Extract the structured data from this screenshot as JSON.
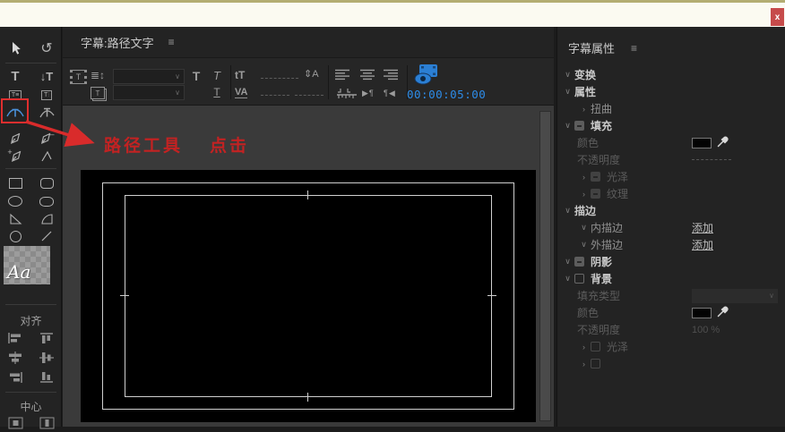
{
  "window": {
    "close": "x"
  },
  "icons": {
    "menu": "≡",
    "chevron_open": "∨",
    "chevron_closed": "›",
    "combo_chevron": "∨",
    "rotate": "↺",
    "type": "T",
    "vertical_type": "↓T",
    "area_type_h": "T≡",
    "area_type_v": "T⫶",
    "pen_minus": "–",
    "pen_plus": "+",
    "roll_crawl": "≣↕",
    "film_t": "T",
    "templates_t": "T",
    "bold_t": "T",
    "italic_t": "T",
    "underline_t": "T",
    "font_size": "tT",
    "leading": "⇕A",
    "kerning": "VA",
    "para_right": "▶¶",
    "para_left": "¶◀"
  },
  "titler": {
    "title": "字幕:路径文字",
    "timecode": "00:00:05:00"
  },
  "annotation": {
    "label": "路径工具",
    "action": "点击"
  },
  "font_preview": "Aa",
  "left": {
    "align_title": "对齐",
    "center_title": "中心"
  },
  "props": {
    "title": "字幕属性",
    "transform": "变换",
    "properties": "属性",
    "distort": "扭曲",
    "fill": "填充",
    "color": "颜色",
    "opacity": "不透明度",
    "sheen": "光泽",
    "texture": "纹理",
    "stroke": "描边",
    "inner_stroke": "内描边",
    "outer_stroke": "外描边",
    "add": "添加",
    "shadow": "阴影",
    "background": "背景",
    "fill_type": "填充类型",
    "bg_opacity_value": "100 %"
  }
}
